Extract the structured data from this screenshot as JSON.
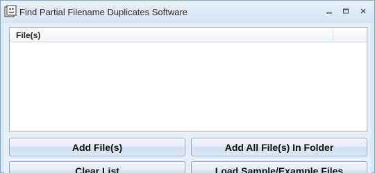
{
  "window": {
    "title": "Find Partial Filename Duplicates Software",
    "icon": "app-icon",
    "controls": [
      "minimize-icon",
      "maximize-icon",
      "close-icon"
    ]
  },
  "file_list": {
    "columns": [
      "File(s)"
    ],
    "rows": []
  },
  "buttons": {
    "add_files": "Add File(s)",
    "add_folder": "Add All File(s) In Folder",
    "clear_list": "Clear List",
    "load_sample": "Load Sample/Example Files"
  },
  "colors": {
    "titlebar": "#dbe8f5",
    "button_face": "#e3ecf7",
    "button_border": "#8ea8c6",
    "list_background": "#ffffff"
  }
}
